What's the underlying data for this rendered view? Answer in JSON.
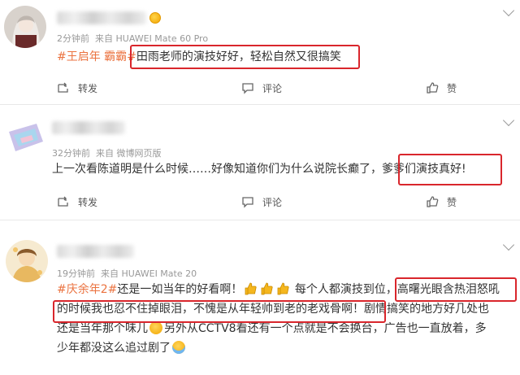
{
  "colors": {
    "accent_topic": "#eb7340",
    "highlight_box": "#d9262c",
    "meta": "#999999"
  },
  "comments": [
    {
      "time": "2分钟前",
      "source": "来自 HUAWEI Mate 60 Pro",
      "topic": "#王启年 霸霸#",
      "text": "田雨老师的演技好好，轻松自然又很搞笑",
      "actions": {
        "repost": "转发",
        "comment": "评论",
        "like": "赞"
      }
    },
    {
      "time": "32分钟前",
      "source": "来自 微博网页版",
      "text_before": "上一次看陈道明是什么时候……好像知道你们为什么说院长癫了，",
      "text_highlight": "爹爹们演技真好!",
      "actions": {
        "repost": "转发",
        "comment": "评论",
        "like": "赞"
      }
    },
    {
      "time": "19分钟前",
      "source": "来自 HUAWEI Mate 20",
      "topic": "#庆余年2#",
      "line1_a": "还是一如当年的好看啊！",
      "line1_b": "每个人都演技到位，",
      "line1_highlight": "高曙光眼含热泪怒吼",
      "line2_highlight": "的时候我也忍不住掉眼泪，不愧是从年轻帅到老的老戏骨啊！",
      "line2_b": "剧情搞笑的地方好几处也",
      "line3": "还是当年那个味儿",
      "line3_b": "另外从CCTV8看还有一个点就是不会换台，广告也一直放着，多",
      "line4": "少年都没这么追过剧了"
    }
  ],
  "icons": {
    "repost": "repost-icon",
    "comment": "comment-icon",
    "like": "thumbs-up-icon",
    "more": "chevron-down-icon"
  }
}
